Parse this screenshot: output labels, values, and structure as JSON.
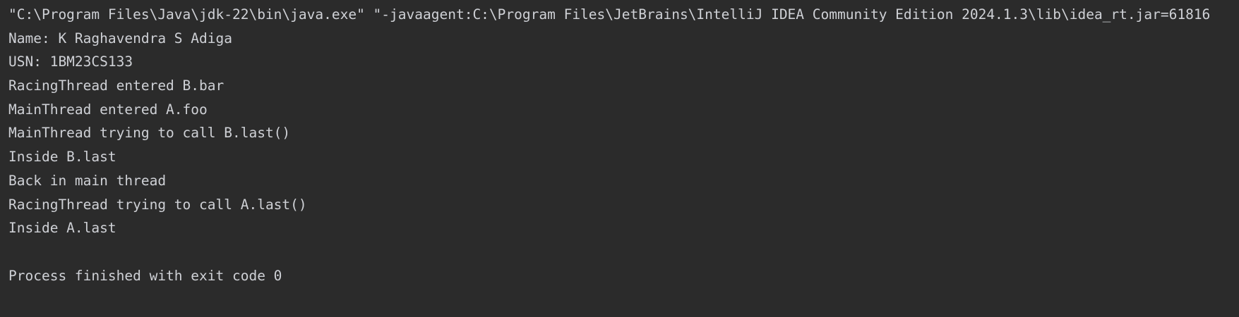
{
  "console": {
    "colors": {
      "background": "#2b2b2b",
      "text": "#cfd1d6"
    },
    "lines": [
      "\"C:\\Program Files\\Java\\jdk-22\\bin\\java.exe\" \"-javaagent:C:\\Program Files\\JetBrains\\IntelliJ IDEA Community Edition 2024.1.3\\lib\\idea_rt.jar=61816",
      "Name: K Raghavendra S Adiga",
      "USN: 1BM23CS133",
      "RacingThread entered B.bar",
      "MainThread entered A.foo",
      "MainThread trying to call B.last()",
      "Inside B.last",
      "Back in main thread",
      "RacingThread trying to call A.last()",
      "Inside A.last",
      "",
      "Process finished with exit code 0"
    ]
  }
}
